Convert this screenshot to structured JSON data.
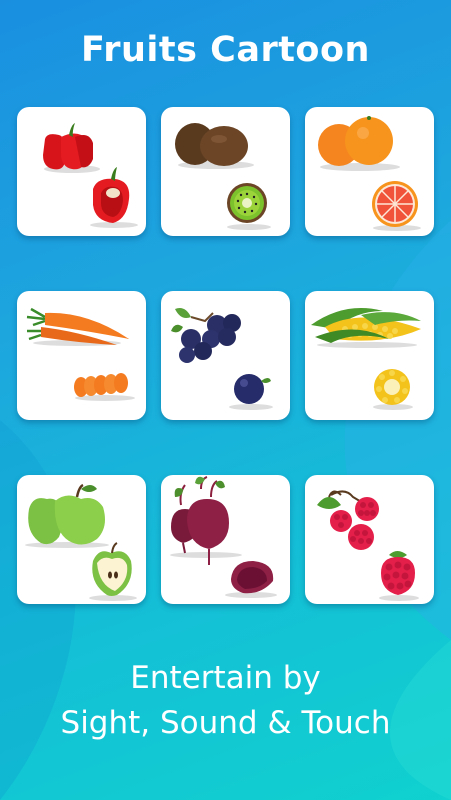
{
  "title": "Fruits Cartoon",
  "tagline": {
    "line1": "Entertain by",
    "line2": "Sight, Sound & Touch"
  },
  "cards": [
    {
      "item": "pepper"
    },
    {
      "item": "kiwi"
    },
    {
      "item": "orange"
    },
    {
      "item": "carrot"
    },
    {
      "item": "blueberry"
    },
    {
      "item": "corn"
    },
    {
      "item": "apple"
    },
    {
      "item": "beet"
    },
    {
      "item": "raspberry"
    }
  ],
  "colors": {
    "background_top": "#1a8fe0",
    "background_bottom": "#10d1cf",
    "card": "#ffffff"
  }
}
